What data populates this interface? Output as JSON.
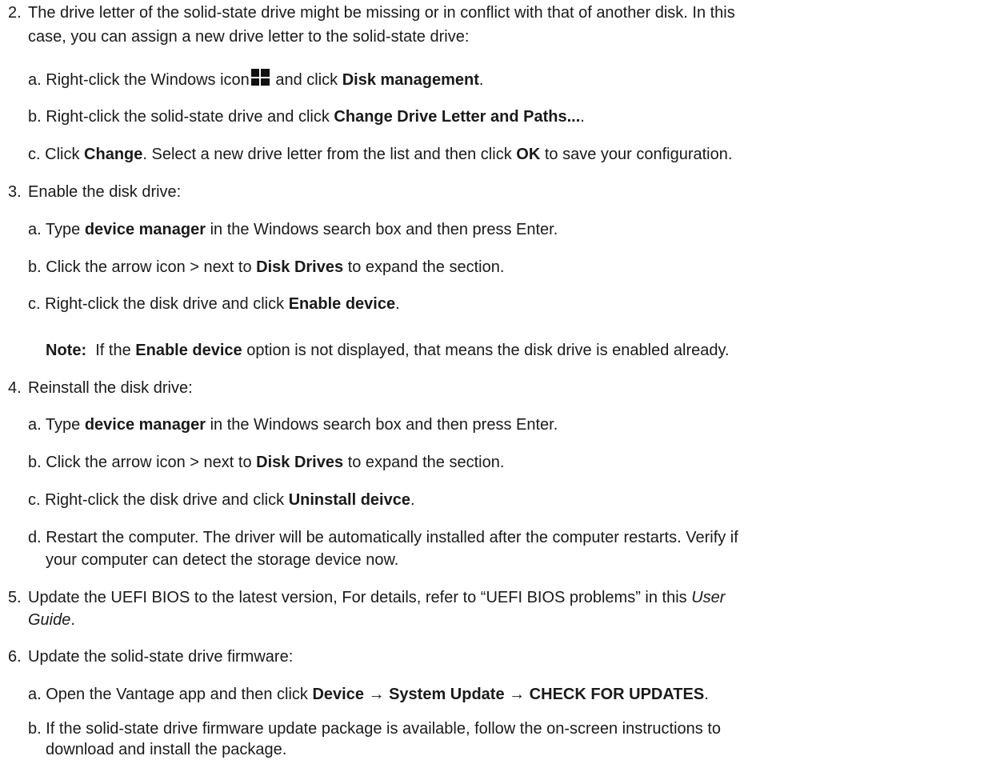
{
  "steps": {
    "s2": {
      "num": "2.",
      "line1": "The drive letter of the solid-state drive might be missing or in conflict with that of another disk. In this",
      "line2": "case, you can assign a new drive letter to the solid-state drive:",
      "a": {
        "label": "a.",
        "t1": "Right-click the Windows icon",
        "t2": "and click",
        "b1": "Disk management",
        "t3": "."
      },
      "b": {
        "label": "b.",
        "t1": "Right-click the solid-state drive and click",
        "b1": "Change Drive Letter and Paths...",
        "t2": "."
      },
      "c": {
        "label": "c.",
        "t1": "Click",
        "b1": "Change",
        "t2": ". Select a new drive letter from the list and then click",
        "b2": "OK",
        "t3": "to save your configuration."
      }
    },
    "s3": {
      "num": "3.",
      "text": "Enable the disk drive:",
      "a": {
        "label": "a.",
        "t1": "Type",
        "b1": "device manager",
        "t2": "in the Windows search box and then press Enter."
      },
      "b": {
        "label": "b.",
        "t1": "Click the arrow icon > next to",
        "b1": "Disk Drives",
        "t2": "to expand the section."
      },
      "c": {
        "label": "c.",
        "t1": "Right-click the disk drive and click",
        "b1": "Enable device",
        "t2": "."
      },
      "note": {
        "b1": "Note:",
        "t1": "If the",
        "b2": "Enable device",
        "t2": "option is not displayed, that means the disk drive is enabled already."
      }
    },
    "s4": {
      "num": "4.",
      "text": "Reinstall the disk drive:",
      "a": {
        "label": "a.",
        "t1": "Type",
        "b1": "device manager",
        "t2": "in the Windows search box and then press Enter."
      },
      "b": {
        "label": "b.",
        "t1": "Click the arrow icon > next to",
        "b1": "Disk Drives",
        "t2": "to expand the section."
      },
      "c": {
        "label": "c.",
        "t1": "Right-click the disk drive and click",
        "b1": "Uninstall deivce",
        "t2": "."
      },
      "d": {
        "label": "d.",
        "line1": "Restart the computer. The driver will be automatically installed after the computer restarts. Verify if",
        "line2": "your computer can detect the storage device now."
      }
    },
    "s5": {
      "num": "5.",
      "line1": "Update the UEFI BIOS to the latest version, For details, refer to “UEFI BIOS problems” in this",
      "italic1": "User",
      "italic2": "Guide",
      "end": "."
    },
    "s6": {
      "num": "6.",
      "text": "Update the solid-state drive firmware:",
      "a": {
        "label": "a.",
        "t1": "Open the Vantage app and then click",
        "b1": "Device → System Update → CHECK FOR UPDATES",
        "t2": "."
      },
      "b": {
        "label": "b.",
        "line1": "If the solid-state drive firmware update package is available, follow the on-screen instructions to",
        "line2": "download and install the package."
      }
    }
  },
  "icons": {
    "windows": "windows-icon"
  }
}
